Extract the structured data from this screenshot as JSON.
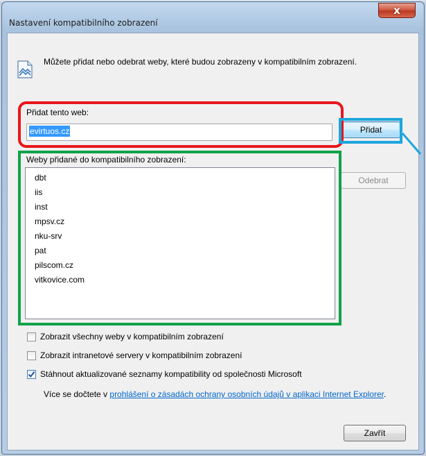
{
  "window": {
    "title": "Nastavení kompatibilního zobrazení",
    "close_label": "x"
  },
  "info": {
    "text": "Můžete přidat nebo odebrat weby, které budou zobrazeny v kompatibilním zobrazení."
  },
  "add_site": {
    "label": "Přidat tento web:",
    "value": "evirtuos.cz",
    "button": "Přidat"
  },
  "sites": {
    "label": "Weby přidané do kompatibilního zobrazení:",
    "items": [
      "dbt",
      "iis",
      "inst",
      "mpsv.cz",
      "nku-srv",
      "pat",
      "pilscom.cz",
      "vitkovice.com"
    ],
    "remove_button": "Odebrat"
  },
  "options": [
    {
      "label": "Zobrazit všechny weby v kompatibilním zobrazení",
      "checked": false
    },
    {
      "label": "Zobrazit intranetové servery v kompatibilním zobrazení",
      "checked": false
    },
    {
      "label": "Stáhnout aktualizované seznamy kompatibility od společnosti Microsoft",
      "checked": true
    }
  ],
  "more_info": {
    "prefix": "Více se dočtete v ",
    "link": "prohlášení o zásadách ochrany osobních údajů v aplikaci Internet Explorer",
    "suffix": "."
  },
  "footer": {
    "close_button": "Zavřít"
  },
  "annotations": {
    "red": "#e8161b",
    "green": "#10a24a",
    "blue": "#1da6dd"
  }
}
